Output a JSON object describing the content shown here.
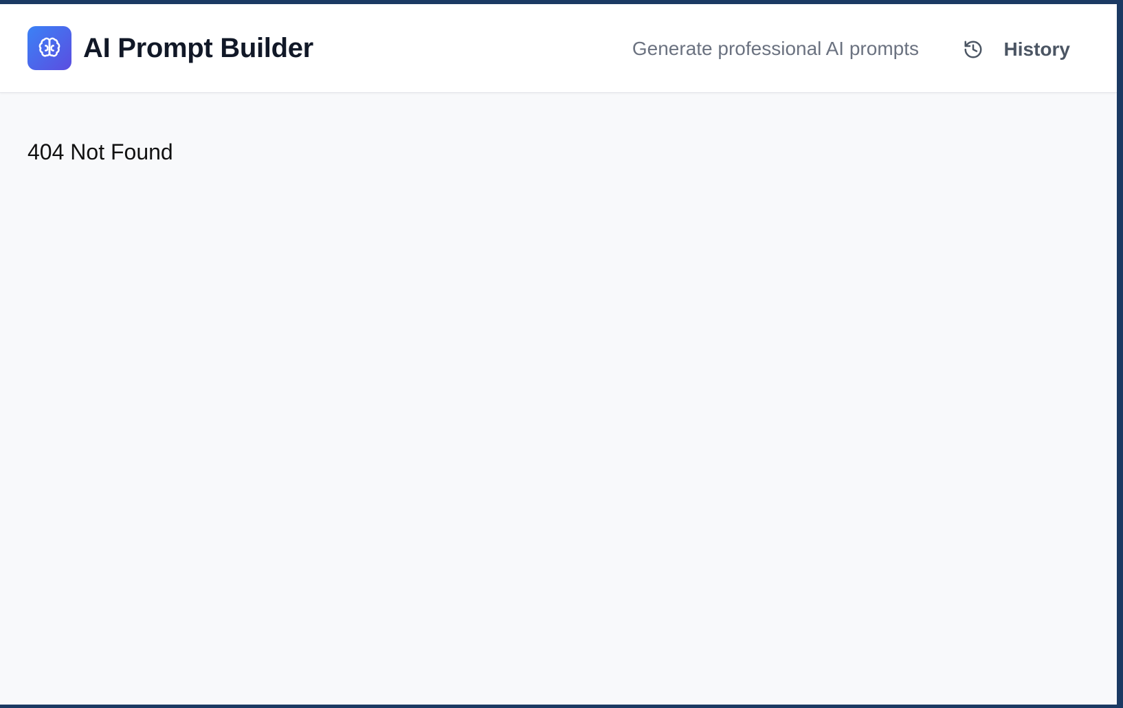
{
  "header": {
    "logo_icon": "brain-icon",
    "title": "AI Prompt Builder",
    "tagline": "Generate professional AI prompts",
    "history": {
      "icon": "history-icon",
      "label": "History"
    }
  },
  "main": {
    "message": "404 Not Found"
  },
  "colors": {
    "accent_start": "#3b82f6",
    "accent_end": "#5b4de0",
    "frame": "#1b3a63",
    "background": "#f8f9fb"
  }
}
